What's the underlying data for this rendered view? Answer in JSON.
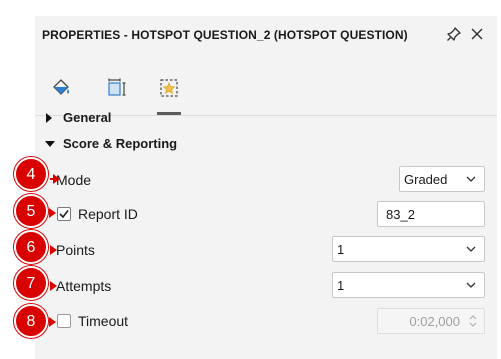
{
  "panel": {
    "title": "PROPERTIES - HOTSPOT QUESTION_2 (HOTSPOT QUESTION)"
  },
  "titlebar_icons": [
    "pin-icon",
    "close-icon"
  ],
  "tabs": [
    {
      "icon": "paint-bucket-icon",
      "active": false
    },
    {
      "icon": "resize-frame-icon",
      "active": false
    },
    {
      "icon": "star-frame-icon",
      "active": true
    }
  ],
  "sections": {
    "general": {
      "label": "General",
      "expanded": false
    },
    "score": {
      "label": "Score & Reporting",
      "expanded": true
    }
  },
  "fields": {
    "mode": {
      "label": "Mode",
      "value": "Graded"
    },
    "report_id": {
      "label": "Report ID",
      "checked": true,
      "value": "83_2"
    },
    "points": {
      "label": "Points",
      "value": "1"
    },
    "attempts": {
      "label": "Attempts",
      "value": "1"
    },
    "timeout": {
      "label": "Timeout",
      "checked": false,
      "value": "0:02,000"
    }
  },
  "annotations": [
    "4",
    "5",
    "6",
    "7",
    "8"
  ],
  "colors": {
    "annotation": "#d90000",
    "panel_bg": "#f3f3f3",
    "icon_blue": "#2f7fd0",
    "icon_orange": "#e5a227"
  }
}
